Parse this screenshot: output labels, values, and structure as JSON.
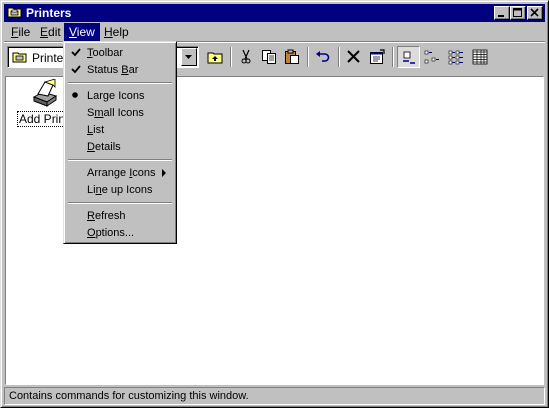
{
  "window": {
    "title": "Printers",
    "icon": "printers-folder-icon"
  },
  "menubar": {
    "items": [
      {
        "label": "File",
        "key": "F",
        "rest": "ile"
      },
      {
        "label": "Edit",
        "key": "E",
        "rest": "dit"
      },
      {
        "label": "View",
        "key": "V",
        "rest": "iew"
      },
      {
        "label": "Help",
        "key": "H",
        "rest": "elp"
      }
    ],
    "active": "View"
  },
  "toolbar": {
    "address_value": "Printers",
    "buttons": [
      "up-one-level-icon",
      "cut-icon",
      "copy-icon",
      "paste-icon",
      "undo-icon",
      "delete-icon",
      "properties-icon",
      "large-icons-view-icon",
      "small-icons-view-icon",
      "list-view-icon",
      "details-view-icon"
    ],
    "pressed": "large-icons-view-icon"
  },
  "content": {
    "items": [
      {
        "label": "Add Printer",
        "icon": "add-printer-icon"
      }
    ]
  },
  "view_menu": {
    "toolbar": {
      "pre": "",
      "key": "T",
      "post": "oolbar",
      "checked": true
    },
    "status_bar": {
      "pre": "Status ",
      "key": "B",
      "post": "ar",
      "checked": true
    },
    "large_icons": {
      "pre": "Lar",
      "key": "g",
      "post": "e Icons",
      "selected": true
    },
    "small_icons": {
      "pre": "S",
      "key": "m",
      "post": "all Icons"
    },
    "list": {
      "pre": "",
      "key": "L",
      "post": "ist"
    },
    "details": {
      "pre": "",
      "key": "D",
      "post": "etails"
    },
    "arrange_icons": {
      "pre": "Arrange ",
      "key": "I",
      "post": "cons",
      "submenu": true
    },
    "line_up_icons": {
      "pre": "Li",
      "key": "n",
      "post": "e up Icons"
    },
    "refresh": {
      "pre": "",
      "key": "R",
      "post": "efresh"
    },
    "options": {
      "pre": "",
      "key": "O",
      "post": "ptions..."
    }
  },
  "statusbar": {
    "text": "Contains commands for customizing this window."
  }
}
